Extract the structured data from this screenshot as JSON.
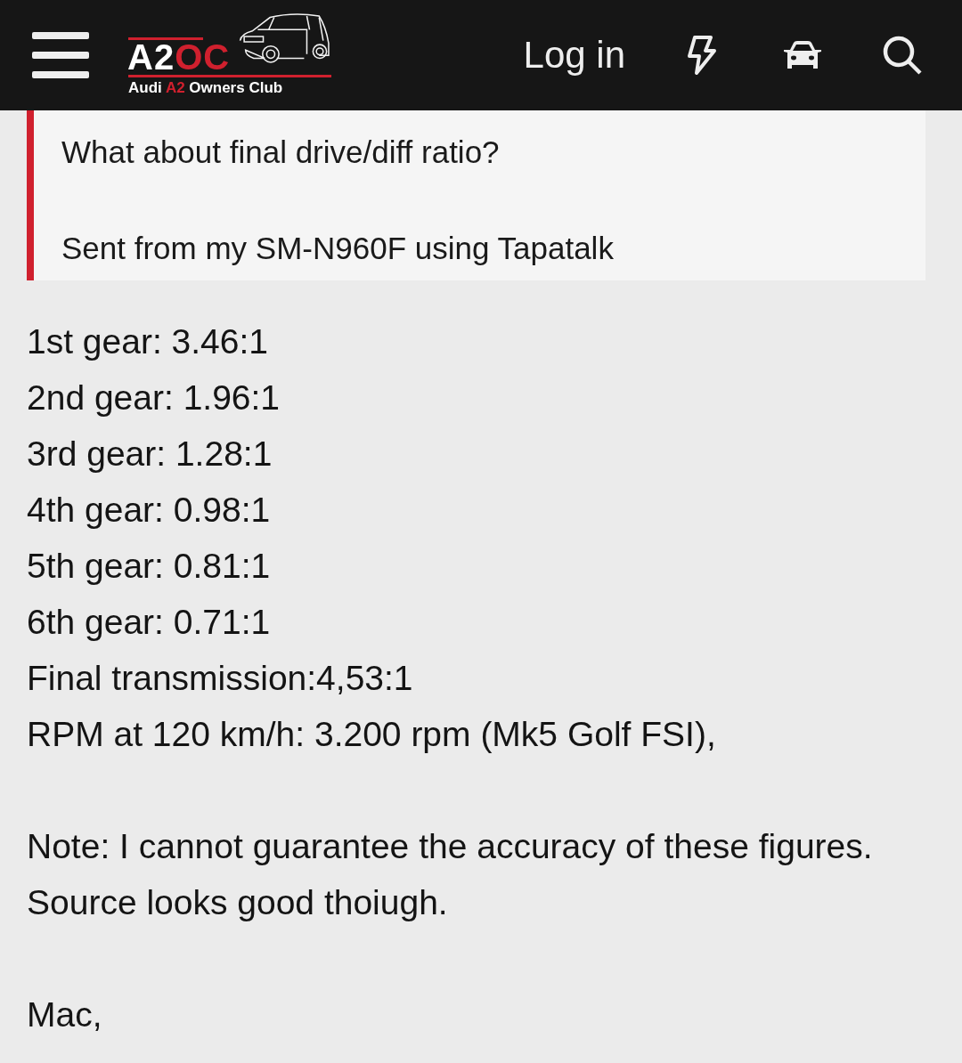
{
  "header": {
    "logo": {
      "mark_start": "A2",
      "mark_end": "OC",
      "tagline_start": "Audi ",
      "tagline_accent": "A2",
      "tagline_end": " Owners Club"
    },
    "login": "Log in"
  },
  "quote": {
    "paragraphs": [
      "What about final drive/diff ratio?",
      "Sent from my SM-N960F using Tapatalk"
    ]
  },
  "post": {
    "paragraphs": [
      [
        "1st gear: 3.46:1",
        "2nd gear: 1.96:1",
        "3rd gear: 1.28:1",
        "4th gear: 0.98:1",
        "5th gear: 0.81:1",
        "6th gear: 0.71:1",
        "Final transmission:4,53:1",
        "RPM at 120 km/h: 3.200 rpm (Mk5 Golf FSI),"
      ],
      [
        "Note: I cannot guarantee the accuracy of these figures. Source looks good thoiugh."
      ],
      [
        "Mac,"
      ]
    ]
  }
}
